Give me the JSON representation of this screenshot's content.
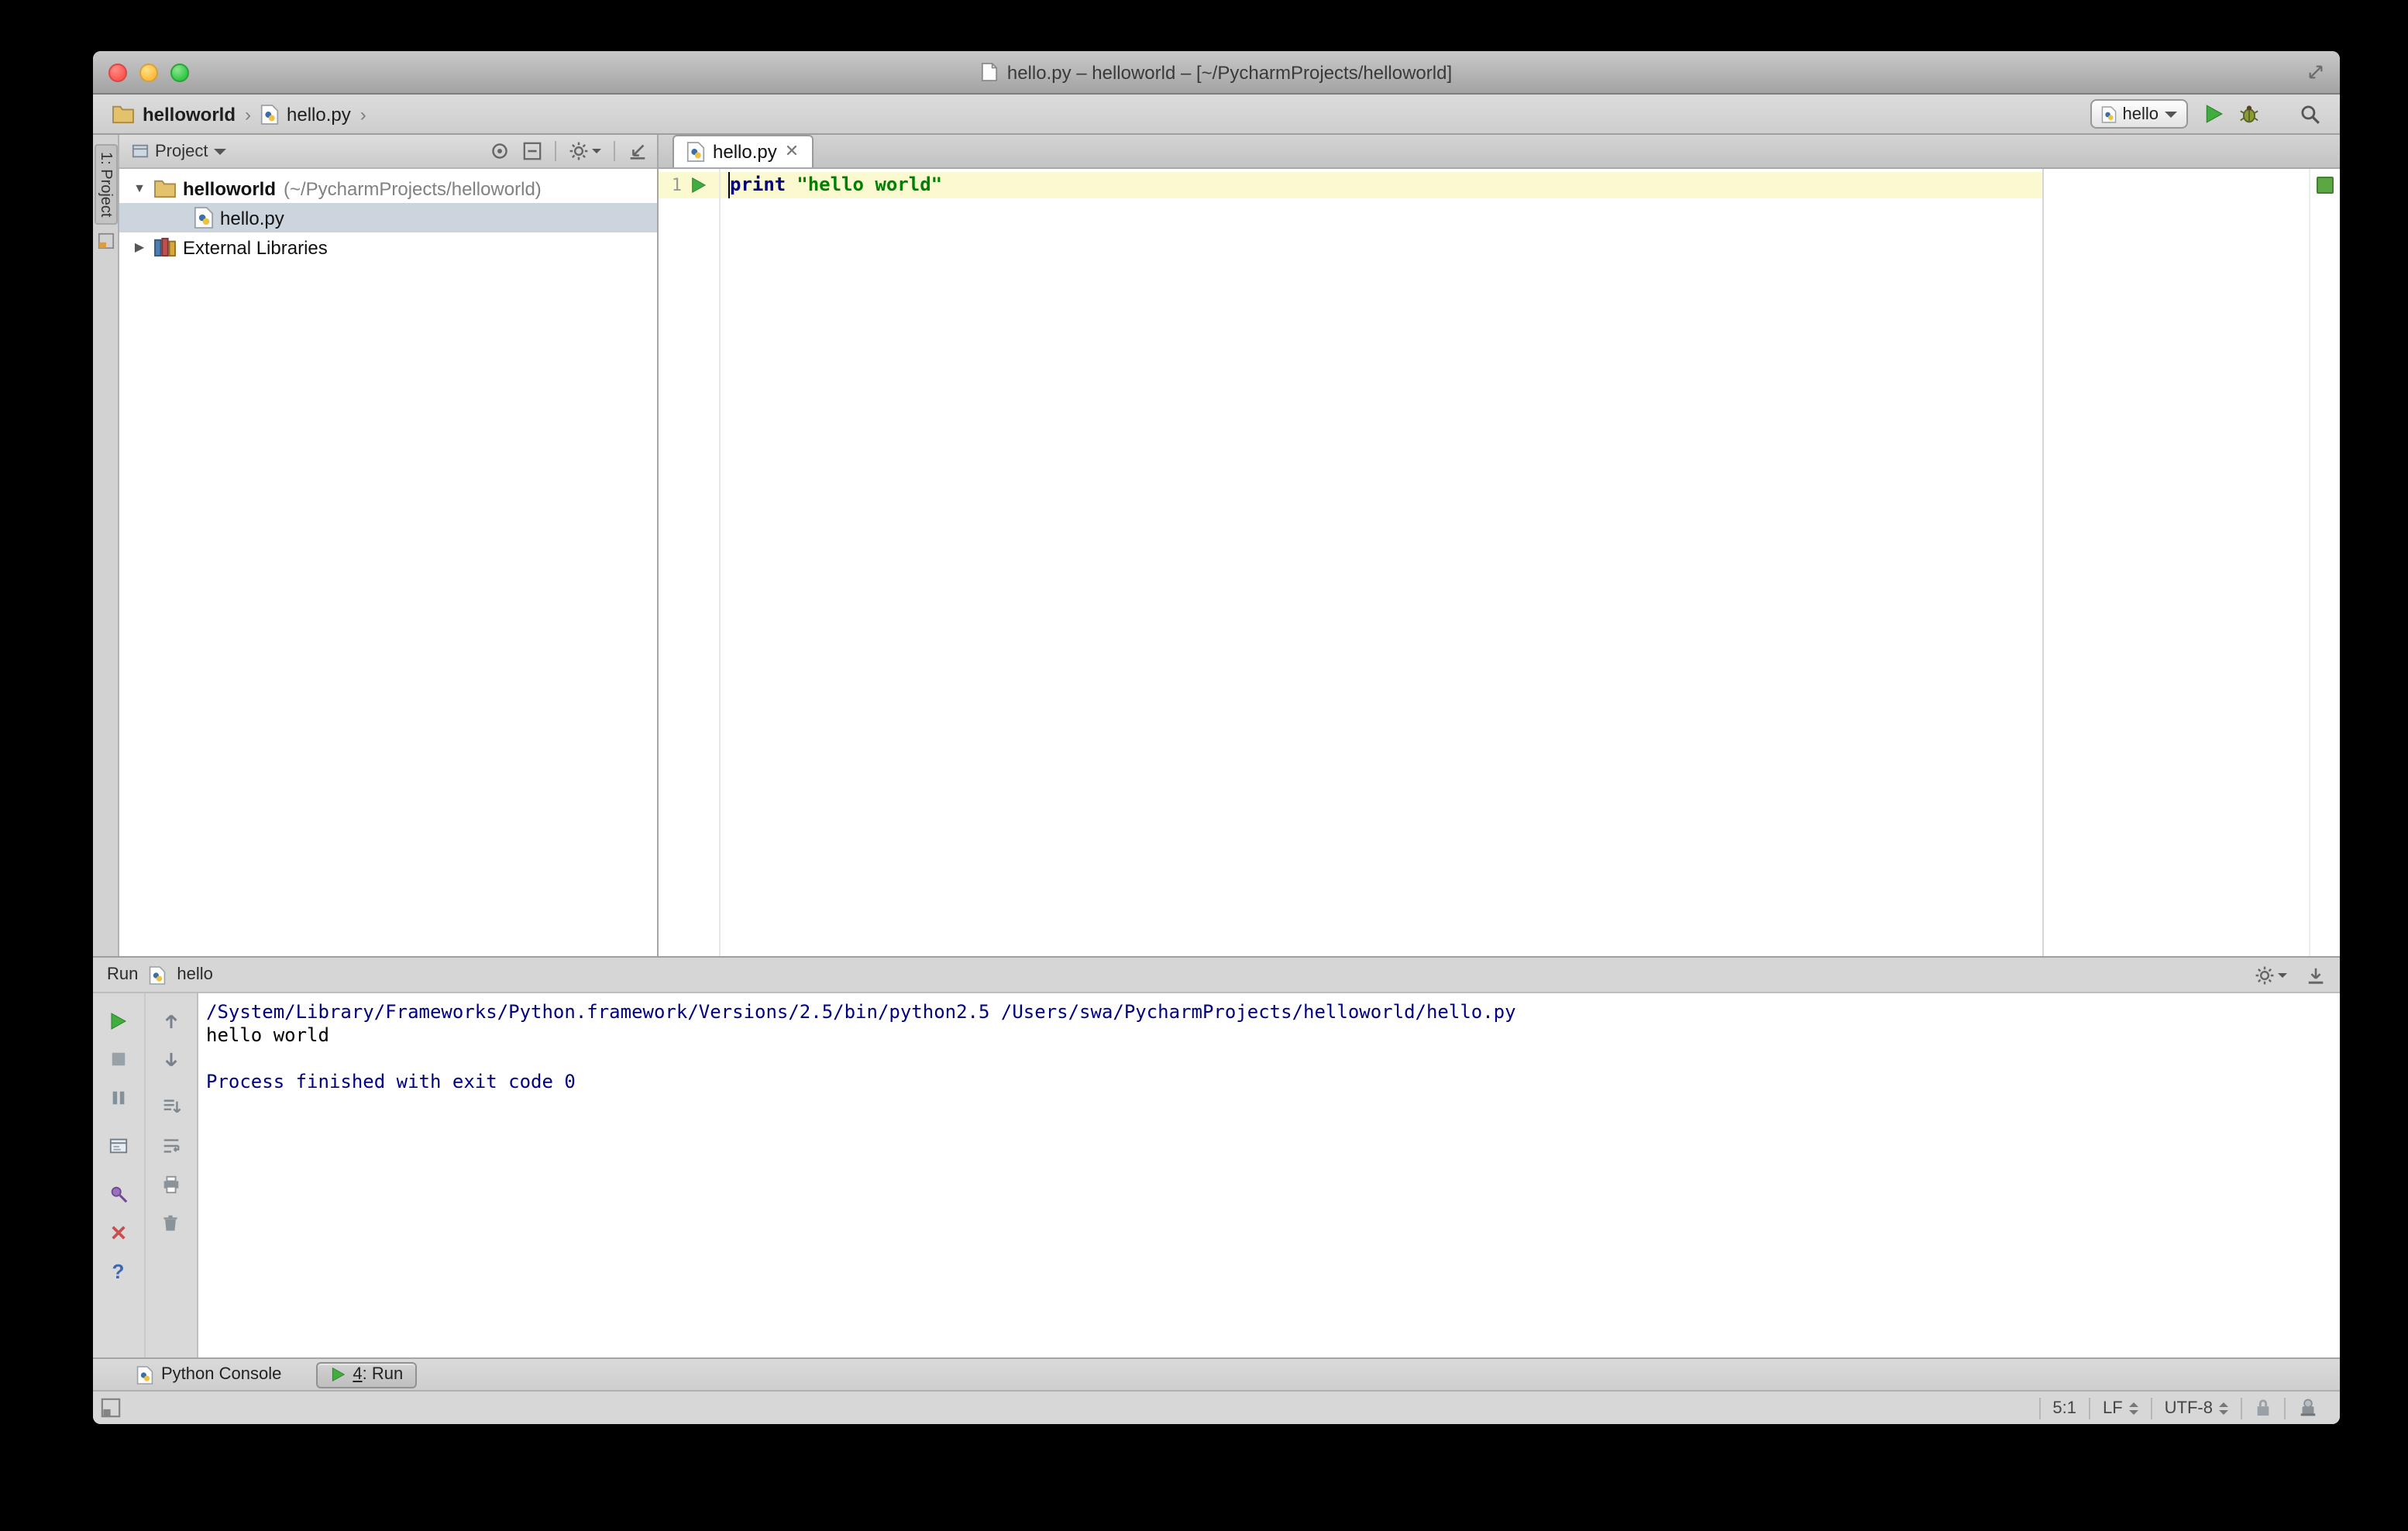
{
  "colors": {
    "keyword": "#000080",
    "string": "#008000",
    "current-line": "#fbf9cf",
    "selection": "#ccd5dd",
    "console-system": "#000080",
    "console-stdout": "#000000",
    "run-green": "#3fae3f"
  },
  "window": {
    "title": "hello.py – helloworld – [~/PycharmProjects/helloworld]"
  },
  "navbar": {
    "breadcrumbs": [
      "helloworld",
      "hello.py"
    ],
    "run_config": "hello"
  },
  "project": {
    "stripe_label": "1: Project",
    "header": "Project",
    "tree": {
      "root_label": "helloworld",
      "root_path": "(~/PycharmProjects/helloworld)",
      "file": "hello.py",
      "libraries": "External Libraries"
    }
  },
  "editor": {
    "tab": "hello.py",
    "line_number": "1",
    "keyword": "print",
    "string": "\"hello world\""
  },
  "run": {
    "title": "Run",
    "config": "hello",
    "console": [
      "/System/Library/Frameworks/Python.framework/Versions/2.5/bin/python2.5 /Users/swa/PycharmProjects/helloworld/hello.py",
      "hello world",
      "",
      "Process finished with exit code 0"
    ]
  },
  "bottom_bar": {
    "console_tab": "Python Console",
    "run_tab_mnemonic": "4",
    "run_tab_label": ": Run"
  },
  "status_bar": {
    "caret": "5:1",
    "line_separator": "LF",
    "encoding": "UTF-8"
  }
}
